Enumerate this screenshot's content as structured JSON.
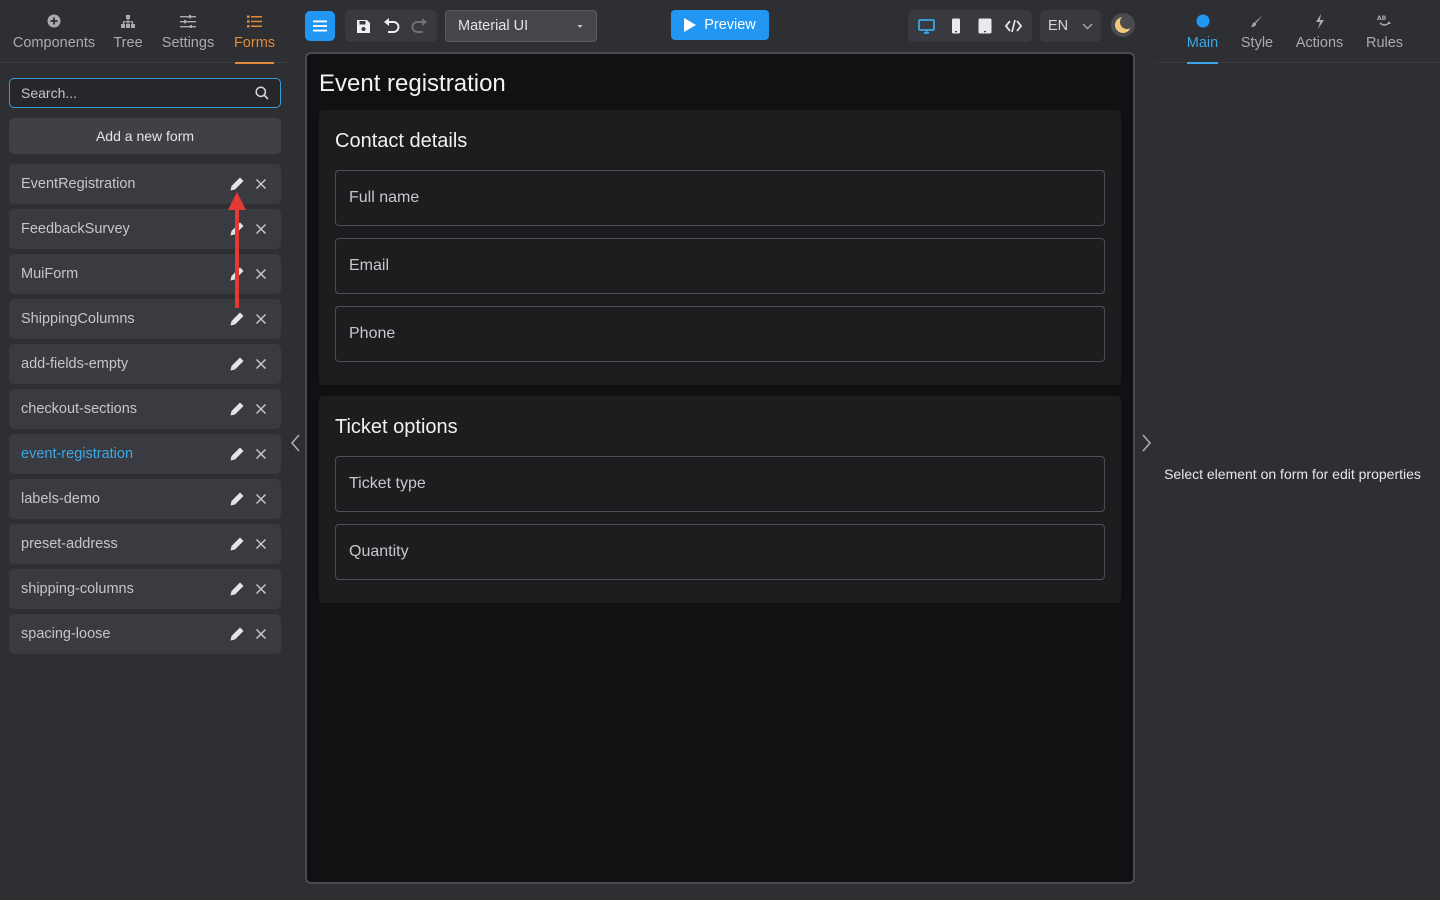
{
  "left_tabs": [
    {
      "label": "Components",
      "icon": "plus-circle-icon"
    },
    {
      "label": "Tree",
      "icon": "tree-icon"
    },
    {
      "label": "Settings",
      "icon": "sliders-icon"
    },
    {
      "label": "Forms",
      "icon": "list-icon",
      "active": true
    }
  ],
  "search": {
    "placeholder": "Search..."
  },
  "add_form_label": "Add a new form",
  "forms": [
    {
      "name": "EventRegistration"
    },
    {
      "name": "FeedbackSurvey"
    },
    {
      "name": "MuiForm"
    },
    {
      "name": "ShippingColumns"
    },
    {
      "name": "add-fields-empty"
    },
    {
      "name": "checkout-sections"
    },
    {
      "name": "event-registration",
      "selected": true
    },
    {
      "name": "labels-demo"
    },
    {
      "name": "preset-address"
    },
    {
      "name": "shipping-columns"
    },
    {
      "name": "spacing-loose"
    }
  ],
  "toolbar": {
    "theme_select_value": "Material UI",
    "preview_label": "Preview",
    "language": "EN"
  },
  "canvas": {
    "form_title": "Event registration",
    "sections": [
      {
        "title": "Contact details",
        "fields": [
          "Full name",
          "Email",
          "Phone"
        ]
      },
      {
        "title": "Ticket options",
        "fields": [
          "Ticket type",
          "Quantity"
        ]
      }
    ]
  },
  "right_tabs": [
    {
      "label": "Main",
      "icon": "dot-icon",
      "active": true
    },
    {
      "label": "Style",
      "icon": "brush-icon"
    },
    {
      "label": "Actions",
      "icon": "lightning-icon"
    },
    {
      "label": "Rules",
      "icon": "rules-icon"
    }
  ],
  "right_panel_message": "Select element on form for edit properties",
  "colors": {
    "accent_blue": "#2196f3",
    "active_tab_orange": "#e2893a",
    "selected_text_blue": "#3aa7e8",
    "annotation_red": "#e53935"
  }
}
